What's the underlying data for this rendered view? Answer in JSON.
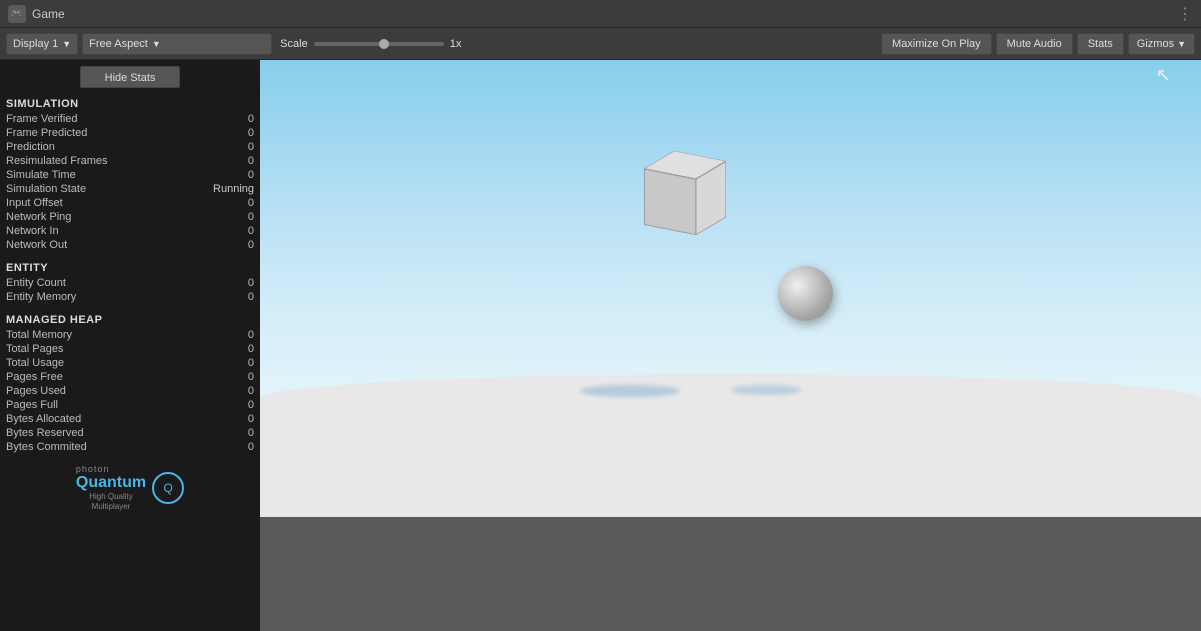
{
  "title_bar": {
    "icon": "🎮",
    "title": "Game",
    "dots": "⋮"
  },
  "toolbar": {
    "display_label": "Display 1",
    "aspect_label": "Free Aspect",
    "scale_label": "Scale",
    "scale_value": "1x",
    "maximize_label": "Maximize On Play",
    "mute_label": "Mute Audio",
    "stats_label": "Stats",
    "gizmos_label": "Gizmos"
  },
  "stats": {
    "hide_btn": "Hide Stats",
    "simulation_title": "SIMULATION",
    "rows_simulation": [
      {
        "label": "Frame Verified",
        "value": "0"
      },
      {
        "label": "Frame Predicted",
        "value": "0"
      },
      {
        "label": "Prediction",
        "value": "0"
      },
      {
        "label": "Resimulated Frames",
        "value": "0"
      },
      {
        "label": "Simulate Time",
        "value": "0"
      },
      {
        "label": "Simulation State",
        "value": "Running"
      },
      {
        "label": "Input Offset",
        "value": "0"
      },
      {
        "label": "Network Ping",
        "value": "0"
      },
      {
        "label": "Network In",
        "value": "0"
      },
      {
        "label": "Network Out",
        "value": "0"
      }
    ],
    "entity_title": "ENTITY",
    "rows_entity": [
      {
        "label": "Entity Count",
        "value": "0"
      },
      {
        "label": "Entity Memory",
        "value": "0"
      }
    ],
    "heap_title": "MANAGED HEAP",
    "rows_heap": [
      {
        "label": "Total Memory",
        "value": "0"
      },
      {
        "label": "Total Pages",
        "value": "0"
      },
      {
        "label": "Total Usage",
        "value": "0"
      },
      {
        "label": "Pages Free",
        "value": "0"
      },
      {
        "label": "Pages Used",
        "value": "0"
      },
      {
        "label": "Pages Full",
        "value": "0"
      },
      {
        "label": "Bytes Allocated",
        "value": "0"
      },
      {
        "label": "Bytes Reserved",
        "value": "0"
      },
      {
        "label": "Bytes Commited",
        "value": "0"
      }
    ]
  },
  "logo": {
    "photon": "photon",
    "quantum": "Quantum",
    "subtitle_line1": "High Quality",
    "subtitle_line2": "Multiplayer",
    "icon": "Q"
  }
}
